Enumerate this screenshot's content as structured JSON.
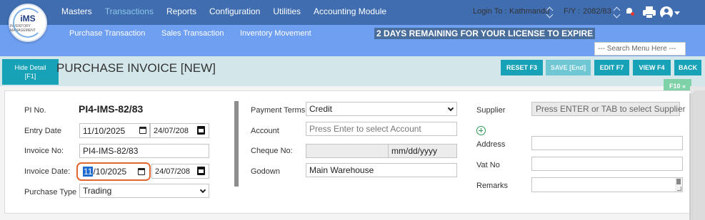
{
  "brand": {
    "logo_text": "iMS",
    "logo_sub": "INVENTORY MANAGEMENT"
  },
  "nav": {
    "items": [
      "Masters",
      "Transactions",
      "Reports",
      "Configuration",
      "Utilities",
      "Accounting Module"
    ],
    "active": "Transactions"
  },
  "session": {
    "login_label": "Login To :",
    "login_value": "Kathmandu",
    "fy_label": "F/Y :",
    "fy_value": "2082/83"
  },
  "subnav": {
    "items": [
      "Purchase Transaction",
      "Sales Transaction",
      "Inventory Movement"
    ]
  },
  "license_notice": "2 DAYS REMAINING FOR YOUR LICENSE TO EXPIRE",
  "menu_search": {
    "placeholder": "--- Search Menu Here ---"
  },
  "toolbar": {
    "hide_detail": "Hide Detail",
    "hide_detail_key": "[F1]",
    "title": "PURCHASE INVOICE [NEW]",
    "reset": "RESET F3",
    "save": "SAVE [End]",
    "edit": "EDIT F7",
    "view": "VIEW F4",
    "back": "BACK",
    "f10": "F10 «"
  },
  "form": {
    "pi_no_label": "PI No.",
    "pi_no_value": "PI4-IMS-82/83",
    "entry_date_label": "Entry Date",
    "entry_date_value": "11/10/2025",
    "entry_date_bs": "24/07/208",
    "invoice_no_label": "Invoice No:",
    "invoice_no_value": "PI4-IMS-82/83",
    "invoice_date_label": "Invoice Date:",
    "invoice_date_month": "11",
    "invoice_date_rest": "/10/2025",
    "invoice_date_bs": "24/07/208",
    "purchase_type_label": "Purchase Type",
    "purchase_type_value": "Trading",
    "payment_terms_label": "Payment Terms",
    "payment_terms_value": "Credit",
    "account_label": "Account",
    "account_placeholder": "Press Enter to select Account",
    "cheque_no_label": "Cheque No:",
    "cheque_date_placeholder": "mm/dd/yyyy",
    "godown_label": "Godown",
    "godown_value": "Main Warehouse",
    "supplier_label": "Supplier",
    "supplier_placeholder": "Press ENTER or TAB to select Supplier",
    "address_label": "Address",
    "vat_no_label": "Vat No",
    "remarks_label": "Remarks"
  },
  "colors": {
    "topbar": "#3f6db0",
    "subbar": "#6f9ff1",
    "accent_button": "#17a2b8",
    "focus_ring": "#e0662f"
  }
}
